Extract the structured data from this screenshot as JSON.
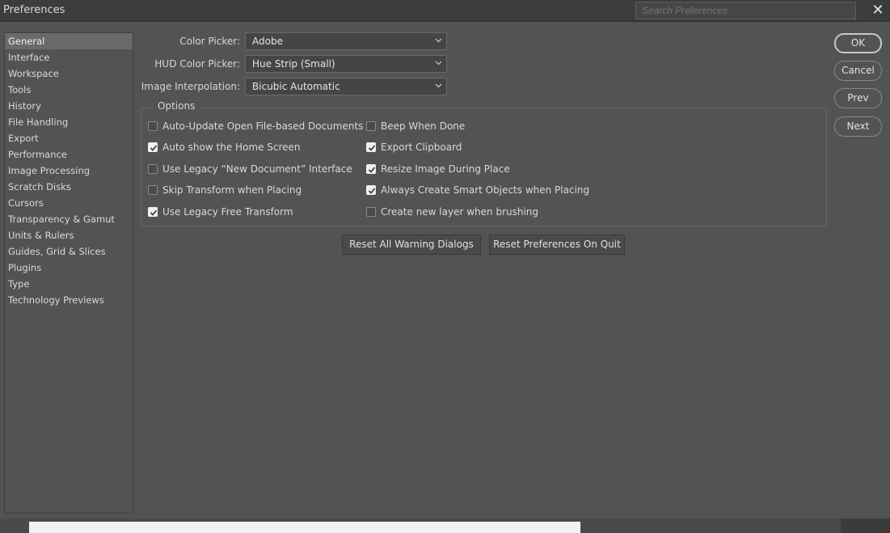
{
  "window": {
    "title": "Preferences",
    "close_glyph": "✕"
  },
  "search": {
    "placeholder": "Search Preferences"
  },
  "sidebar": {
    "items": [
      {
        "label": "General",
        "active": true
      },
      {
        "label": "Interface"
      },
      {
        "label": "Workspace"
      },
      {
        "label": "Tools"
      },
      {
        "label": "History"
      },
      {
        "label": "File Handling"
      },
      {
        "label": "Export"
      },
      {
        "label": "Performance"
      },
      {
        "label": "Image Processing"
      },
      {
        "label": "Scratch Disks"
      },
      {
        "label": "Cursors"
      },
      {
        "label": "Transparency & Gamut"
      },
      {
        "label": "Units & Rulers"
      },
      {
        "label": "Guides, Grid & Slices"
      },
      {
        "label": "Plugins"
      },
      {
        "label": "Type"
      },
      {
        "label": "Technology Previews"
      }
    ]
  },
  "fields": {
    "color_picker": {
      "label": "Color Picker:",
      "value": "Adobe"
    },
    "hud_color_picker": {
      "label": "HUD Color Picker:",
      "value": "Hue Strip (Small)"
    },
    "image_interpolation": {
      "label": "Image Interpolation:",
      "value": "Bicubic Automatic"
    }
  },
  "options": {
    "title": "Options",
    "left": [
      {
        "label": "Auto-Update Open File-based Documents",
        "checked": false
      },
      {
        "label": "Auto show the Home Screen",
        "checked": true
      },
      {
        "label": "Use Legacy “New Document” Interface",
        "checked": false
      },
      {
        "label": "Skip Transform when Placing",
        "checked": false
      },
      {
        "label": "Use Legacy Free Transform",
        "checked": true
      }
    ],
    "right": [
      {
        "label": "Beep When Done",
        "checked": false
      },
      {
        "label": "Export Clipboard",
        "checked": true
      },
      {
        "label": "Resize Image During Place",
        "checked": true
      },
      {
        "label": "Always Create Smart Objects when Placing",
        "checked": true
      },
      {
        "label": "Create new layer when brushing",
        "checked": false
      }
    ]
  },
  "actions": {
    "reset_warnings": "Reset All Warning Dialogs",
    "reset_prefs": "Reset Preferences On Quit"
  },
  "buttons": {
    "ok": "OK",
    "cancel": "Cancel",
    "prev": "Prev",
    "next": "Next"
  },
  "colors": {
    "background": "#535353",
    "titlebar": "#3c3c3c",
    "active_item": "#6a6a6a",
    "checkbox_checked": "#efefef"
  }
}
